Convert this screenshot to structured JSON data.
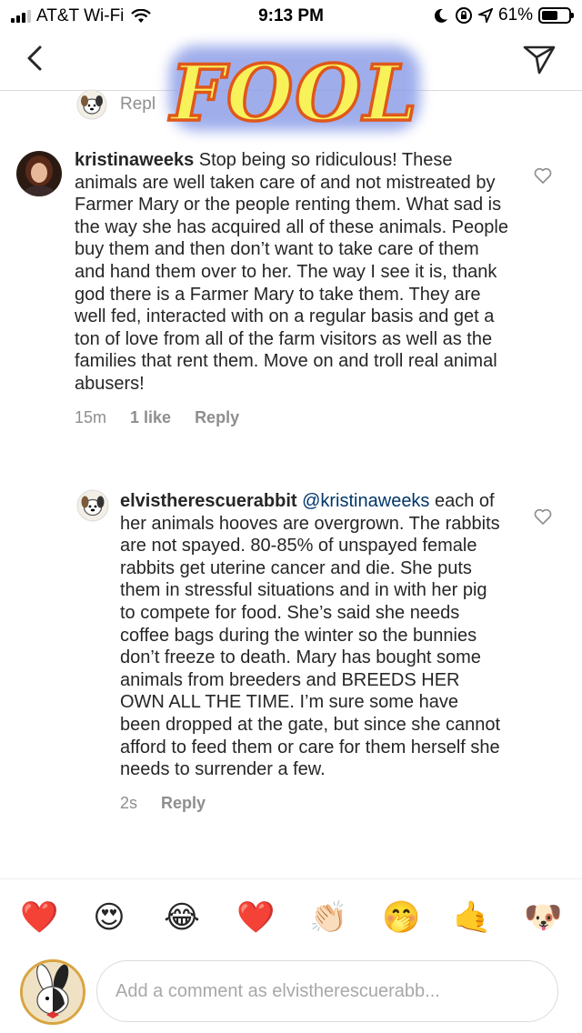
{
  "status_bar": {
    "carrier": "AT&T Wi-Fi",
    "time": "9:13 PM",
    "battery": "61%",
    "battery_level": 0.61,
    "icons": [
      "signal-icon",
      "wifi-icon",
      "moon-icon",
      "orientation-lock-icon",
      "location-icon",
      "battery-icon"
    ]
  },
  "nav": {
    "back_icon": "chevron-left-icon",
    "send_icon": "paper-plane-icon"
  },
  "overlay": {
    "text": "FOOL",
    "fill_color": "#f8f25a",
    "stroke_color": "#e0571b",
    "glow_color": "#8fa0e8"
  },
  "top_reply": {
    "label": "Repl"
  },
  "comments": [
    {
      "username": "kristinaweeks",
      "text": " Stop being so ridiculous! These animals are well taken care of and not mistreated by Farmer Mary or the people renting them. What sad is the way she has acquired all of these animals. People buy them and then don’t want to take care of them and hand them over to her. The way I see it is, thank god there is a Farmer Mary to take them. They are well fed, interacted with on a regular basis and get a ton of love from all of the farm visitors as well as the families that rent them. Move on and troll real animal abusers!",
      "time": "15m",
      "likes": "1 like",
      "reply": "Reply"
    },
    {
      "username": "elvistherescuerabbit",
      "mention": "@kristinaweeks",
      "text": "each of her animals hooves are overgrown. The rabbits are not spayed. 80-85% of unspayed female rabbits get uterine cancer and die. She puts them in stressful situations and in with her pig to compete for food. She’s said she needs coffee bags during the winter so the bunnies don’t freeze to death. Mary has bought some animals from breeders and BREEDS HER OWN ALL THE TIME. I’m sure some have been dropped at the gate, but since she cannot afford to feed them or care for them herself she needs to surrender a few.",
      "time": "2s",
      "reply": "Reply"
    }
  ],
  "emoji_bar": [
    {
      "name": "red-heart-emoji",
      "glyph": "❤️"
    },
    {
      "name": "heart-eyes-emoji",
      "glyph": "😍"
    },
    {
      "name": "tears-of-joy-emoji",
      "glyph": "😂"
    },
    {
      "name": "red-heart-emoji-2",
      "glyph": "❤️"
    },
    {
      "name": "clapping-hands-emoji",
      "glyph": "👏🏻"
    },
    {
      "name": "face-with-hand-over-mouth-emoji",
      "glyph": "🤭"
    },
    {
      "name": "call-me-hand-emoji",
      "glyph": "🤙"
    },
    {
      "name": "dog-face-emoji",
      "glyph": "🐶"
    }
  ],
  "composer": {
    "placeholder": "Add a comment as elvistherescuerabb..."
  },
  "colors": {
    "secondary_text": "#8e8e8e",
    "mention": "#003569",
    "divider": "#dbdbdb"
  }
}
